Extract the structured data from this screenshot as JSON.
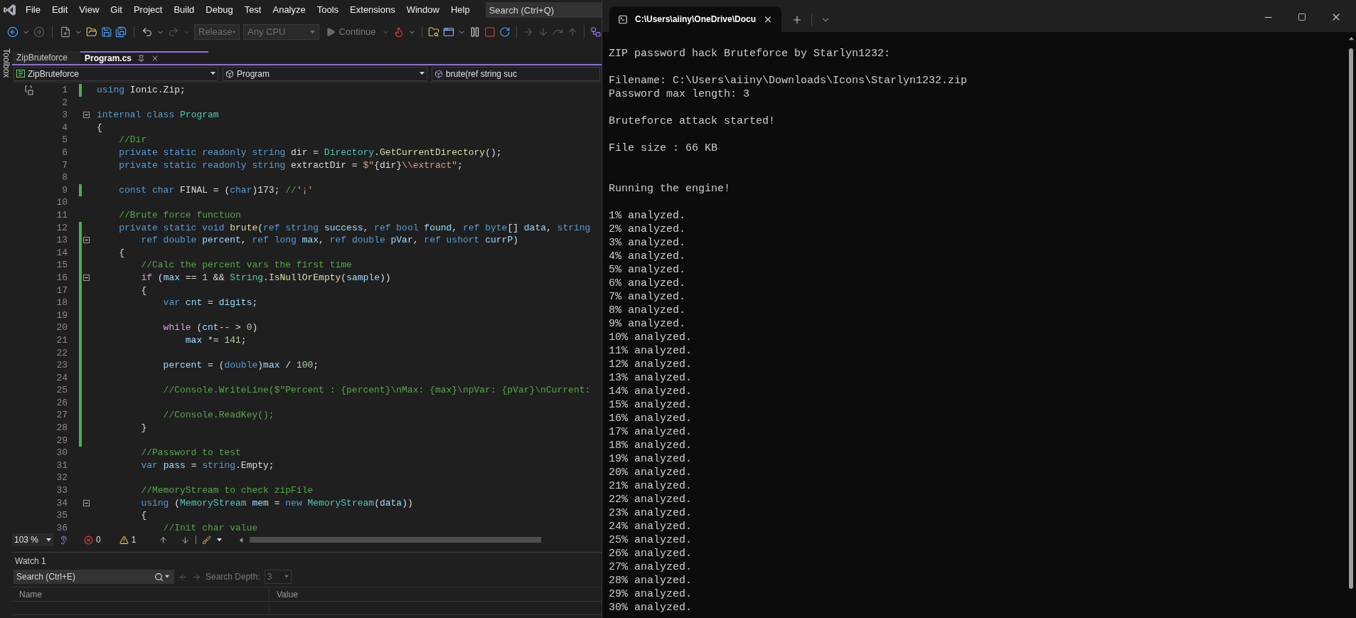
{
  "menu_bar": {
    "items": [
      "File",
      "Edit",
      "View",
      "Git",
      "Project",
      "Build",
      "Debug",
      "Test",
      "Analyze",
      "Tools",
      "Extensions",
      "Window",
      "Help"
    ],
    "search": {
      "placeholder": "Search (Ctrl+Q)"
    }
  },
  "toolbar": {
    "configuration": {
      "value": "Release",
      "disabled": true
    },
    "platform": {
      "value": "Any CPU",
      "disabled": true
    },
    "continue_button": {
      "label": "Continue",
      "disabled": true
    }
  },
  "side_tab": "Toolbox",
  "document_tabs": [
    {
      "label": "ZipBruteforce",
      "selected": false
    },
    {
      "label": "Program.cs",
      "selected": true
    }
  ],
  "navigation_bar": [
    "ZipBruteforce",
    "Program",
    "brute(ref string suc"
  ],
  "code_lines": [
    {
      "number": "1",
      "changed": true,
      "foldable": false,
      "tokens": [
        {
          "kind": "keyword",
          "text": "using"
        },
        {
          "kind": "plain",
          "text": " Ionic.Zip;"
        }
      ]
    },
    {
      "number": "2",
      "changed": false,
      "foldable": false
    },
    {
      "number": "3",
      "changed": false,
      "foldable": true,
      "tokens": [
        {
          "kind": "keyword",
          "text": "internal class "
        },
        {
          "kind": "type",
          "text": "Program"
        }
      ]
    },
    {
      "number": "4",
      "changed": false,
      "foldable": false,
      "tokens": [
        {
          "kind": "plain",
          "text": "{"
        }
      ]
    },
    {
      "number": "5",
      "changed": false,
      "foldable": false,
      "tokens": [
        {
          "kind": "comment",
          "text": "    //Dir"
        }
      ]
    },
    {
      "number": "6",
      "changed": false,
      "foldable": false,
      "tokens": [
        {
          "kind": "keyword",
          "text": "    private static readonly string "
        },
        {
          "kind": "plain",
          "text": "dir = "
        },
        {
          "kind": "type",
          "text": "Directory"
        },
        {
          "kind": "plain",
          "text": "."
        },
        {
          "kind": "method",
          "text": "GetCurrentDirectory"
        },
        {
          "kind": "plain",
          "text": "();"
        }
      ]
    },
    {
      "number": "7",
      "changed": false,
      "foldable": false,
      "tokens": [
        {
          "kind": "keyword",
          "text": "    private static readonly string "
        },
        {
          "kind": "plain",
          "text": "extractDir = "
        },
        {
          "kind": "string",
          "text": "$\""
        },
        {
          "kind": "plain",
          "text": "{dir}"
        },
        {
          "kind": "string",
          "text": "\\\\extract\""
        },
        {
          "kind": "plain",
          "text": ";"
        }
      ]
    },
    {
      "number": "8",
      "changed": false,
      "foldable": false
    },
    {
      "number": "9",
      "changed": true,
      "foldable": false,
      "tokens": [
        {
          "kind": "keyword",
          "text": "    const char "
        },
        {
          "kind": "plain",
          "text": "FINAL = ("
        },
        {
          "kind": "keyword",
          "text": "char"
        },
        {
          "kind": "plain",
          "text": ")173; "
        },
        {
          "kind": "comment",
          "text": "//"
        },
        {
          "kind": "string",
          "text": "'¡'"
        }
      ]
    },
    {
      "number": "10",
      "changed": false,
      "foldable": false
    },
    {
      "number": "11",
      "changed": false,
      "foldable": false,
      "tokens": [
        {
          "kind": "comment",
          "text": "    //Brute force functuon"
        }
      ]
    },
    {
      "number": "12",
      "changed": true,
      "foldable": false,
      "tokens": [
        {
          "kind": "keyword",
          "text": "    private static void "
        },
        {
          "kind": "method",
          "text": "brute"
        },
        {
          "kind": "plain",
          "text": "("
        },
        {
          "kind": "keyword",
          "text": "ref string "
        },
        {
          "kind": "variable",
          "text": "success"
        },
        {
          "kind": "plain",
          "text": ", "
        },
        {
          "kind": "keyword",
          "text": "ref bool "
        },
        {
          "kind": "variable",
          "text": "found"
        },
        {
          "kind": "plain",
          "text": ", "
        },
        {
          "kind": "keyword",
          "text": "ref byte"
        },
        {
          "kind": "plain",
          "text": "[] "
        },
        {
          "kind": "variable",
          "text": "data"
        },
        {
          "kind": "plain",
          "text": ", "
        },
        {
          "kind": "keyword",
          "text": "string"
        }
      ]
    },
    {
      "number": "13",
      "changed": true,
      "foldable": true,
      "tokens": [
        {
          "kind": "keyword",
          "text": "        ref double "
        },
        {
          "kind": "variable",
          "text": "percent"
        },
        {
          "kind": "plain",
          "text": ", "
        },
        {
          "kind": "keyword",
          "text": "ref long "
        },
        {
          "kind": "variable",
          "text": "max"
        },
        {
          "kind": "plain",
          "text": ", "
        },
        {
          "kind": "keyword",
          "text": "ref double "
        },
        {
          "kind": "variable",
          "text": "pVar"
        },
        {
          "kind": "plain",
          "text": ", "
        },
        {
          "kind": "keyword",
          "text": "ref ushort "
        },
        {
          "kind": "variable",
          "text": "currP"
        },
        {
          "kind": "plain",
          "text": ")"
        }
      ]
    },
    {
      "number": "14",
      "changed": true,
      "foldable": false,
      "tokens": [
        {
          "kind": "plain",
          "text": "    {"
        }
      ]
    },
    {
      "number": "15",
      "changed": true,
      "foldable": false,
      "tokens": [
        {
          "kind": "comment",
          "text": "        //Calc the percent vars the first time"
        }
      ]
    },
    {
      "number": "16",
      "changed": true,
      "foldable": true,
      "tokens": [
        {
          "kind": "control",
          "text": "        if"
        },
        {
          "kind": "plain",
          "text": " ("
        },
        {
          "kind": "variable",
          "text": "max"
        },
        {
          "kind": "plain",
          "text": " == "
        },
        {
          "kind": "number",
          "text": "1"
        },
        {
          "kind": "plain",
          "text": " && "
        },
        {
          "kind": "type",
          "text": "String"
        },
        {
          "kind": "plain",
          "text": "."
        },
        {
          "kind": "method",
          "text": "IsNullOrEmpty"
        },
        {
          "kind": "plain",
          "text": "("
        },
        {
          "kind": "variable",
          "text": "sample"
        },
        {
          "kind": "plain",
          "text": "))"
        }
      ]
    },
    {
      "number": "17",
      "changed": true,
      "foldable": false,
      "tokens": [
        {
          "kind": "plain",
          "text": "        {"
        }
      ]
    },
    {
      "number": "18",
      "changed": true,
      "foldable": false,
      "tokens": [
        {
          "kind": "keyword",
          "text": "            var "
        },
        {
          "kind": "variable",
          "text": "cnt"
        },
        {
          "kind": "plain",
          "text": " = "
        },
        {
          "kind": "variable",
          "text": "digits"
        },
        {
          "kind": "plain",
          "text": ";"
        }
      ]
    },
    {
      "number": "19",
      "changed": true,
      "foldable": false
    },
    {
      "number": "20",
      "changed": true,
      "foldable": false,
      "tokens": [
        {
          "kind": "control",
          "text": "            while"
        },
        {
          "kind": "plain",
          "text": " ("
        },
        {
          "kind": "variable",
          "text": "cnt"
        },
        {
          "kind": "plain",
          "text": "-- > "
        },
        {
          "kind": "number",
          "text": "0"
        },
        {
          "kind": "plain",
          "text": ")"
        }
      ]
    },
    {
      "number": "21",
      "changed": true,
      "foldable": false,
      "tokens": [
        {
          "kind": "variable",
          "text": "                max"
        },
        {
          "kind": "plain",
          "text": " *= "
        },
        {
          "kind": "number",
          "text": "141"
        },
        {
          "kind": "plain",
          "text": ";"
        }
      ]
    },
    {
      "number": "22",
      "changed": true,
      "foldable": false
    },
    {
      "number": "23",
      "changed": true,
      "foldable": false,
      "tokens": [
        {
          "kind": "variable",
          "text": "            percent"
        },
        {
          "kind": "plain",
          "text": " = ("
        },
        {
          "kind": "keyword",
          "text": "double"
        },
        {
          "kind": "plain",
          "text": ")"
        },
        {
          "kind": "variable",
          "text": "max"
        },
        {
          "kind": "plain",
          "text": " / "
        },
        {
          "kind": "number",
          "text": "100"
        },
        {
          "kind": "plain",
          "text": ";"
        }
      ]
    },
    {
      "number": "24",
      "changed": true,
      "foldable": false
    },
    {
      "number": "25",
      "changed": true,
      "foldable": false,
      "tokens": [
        {
          "kind": "comment",
          "text": "            //Console.WriteLine($\"Percent : {percent}\\nMax: {max}\\npVar: {pVar}\\nCurrent:"
        }
      ]
    },
    {
      "number": "26",
      "changed": true,
      "foldable": false
    },
    {
      "number": "27",
      "changed": true,
      "foldable": false,
      "tokens": [
        {
          "kind": "comment",
          "text": "            //Console.ReadKey();"
        }
      ]
    },
    {
      "number": "28",
      "changed": true,
      "foldable": false,
      "tokens": [
        {
          "kind": "plain",
          "text": "        }"
        }
      ]
    },
    {
      "number": "29",
      "changed": true,
      "foldable": false
    },
    {
      "number": "30",
      "changed": false,
      "foldable": false,
      "tokens": [
        {
          "kind": "comment",
          "text": "        //Password to test"
        }
      ]
    },
    {
      "number": "31",
      "changed": false,
      "foldable": false,
      "tokens": [
        {
          "kind": "keyword",
          "text": "        var "
        },
        {
          "kind": "variable",
          "text": "pass"
        },
        {
          "kind": "plain",
          "text": " = "
        },
        {
          "kind": "keyword",
          "text": "string"
        },
        {
          "kind": "plain",
          "text": ".Empty;"
        }
      ]
    },
    {
      "number": "32",
      "changed": false,
      "foldable": false
    },
    {
      "number": "33",
      "changed": false,
      "foldable": false,
      "tokens": [
        {
          "kind": "comment",
          "text": "        //MemoryStream to check zipFile"
        }
      ]
    },
    {
      "number": "34",
      "changed": false,
      "foldable": true,
      "tokens": [
        {
          "kind": "keyword",
          "text": "        using"
        },
        {
          "kind": "plain",
          "text": " ("
        },
        {
          "kind": "type",
          "text": "MemoryStream"
        },
        {
          "kind": "variable",
          "text": " mem"
        },
        {
          "kind": "plain",
          "text": " = "
        },
        {
          "kind": "keyword",
          "text": "new "
        },
        {
          "kind": "type",
          "text": "MemoryStream"
        },
        {
          "kind": "plain",
          "text": "("
        },
        {
          "kind": "variable",
          "text": "data"
        },
        {
          "kind": "plain",
          "text": "))"
        }
      ]
    },
    {
      "number": "35",
      "changed": false,
      "foldable": false,
      "tokens": [
        {
          "kind": "plain",
          "text": "        {"
        }
      ]
    },
    {
      "number": "36",
      "changed": false,
      "foldable": false,
      "tokens": [
        {
          "kind": "comment",
          "text": "            //Init char value"
        }
      ]
    }
  ],
  "status": {
    "zoom": "103 %",
    "errors": "0",
    "warnings": "1"
  },
  "watch": {
    "title": "Watch 1",
    "search": {
      "placeholder": "Search (Ctrl+E)"
    },
    "depth_label": "Search Depth:",
    "depth": {
      "value": "3",
      "disabled": true
    },
    "columns": [
      "Name",
      "Value"
    ]
  },
  "terminal": {
    "tab_title": "C:\\Users\\aiiny\\OneDrive\\Docu",
    "blocks": [
      {
        "kind": "single",
        "lines": [
          "ZIP password hack Bruteforce by Starlyn1232:"
        ]
      },
      {
        "kind": "single",
        "lines": [
          "Filename: C:\\Users\\aiiny\\Downloads\\Icons\\Starlyn1232.zip",
          "Password max length: 3"
        ]
      },
      {
        "kind": "single",
        "lines": [
          "Bruteforce attack started!"
        ]
      },
      {
        "kind": "single",
        "lines": [
          "File size : 66 KB"
        ]
      },
      {
        "kind": "double",
        "lines": [
          "Running the engine!"
        ]
      },
      {
        "kind": "single",
        "lines": [
          "1% analyzed.",
          "2% analyzed.",
          "3% analyzed.",
          "4% analyzed.",
          "5% analyzed.",
          "6% analyzed.",
          "7% analyzed.",
          "8% analyzed.",
          "9% analyzed.",
          "10% analyzed.",
          "11% analyzed.",
          "12% analyzed.",
          "13% analyzed.",
          "14% analyzed.",
          "15% analyzed.",
          "16% analyzed.",
          "17% analyzed.",
          "18% analyzed.",
          "19% analyzed.",
          "20% analyzed.",
          "21% analyzed.",
          "22% analyzed.",
          "23% analyzed.",
          "24% analyzed.",
          "25% analyzed.",
          "26% analyzed.",
          "27% analyzed.",
          "28% analyzed.",
          "29% analyzed.",
          "30% analyzed."
        ]
      }
    ]
  }
}
